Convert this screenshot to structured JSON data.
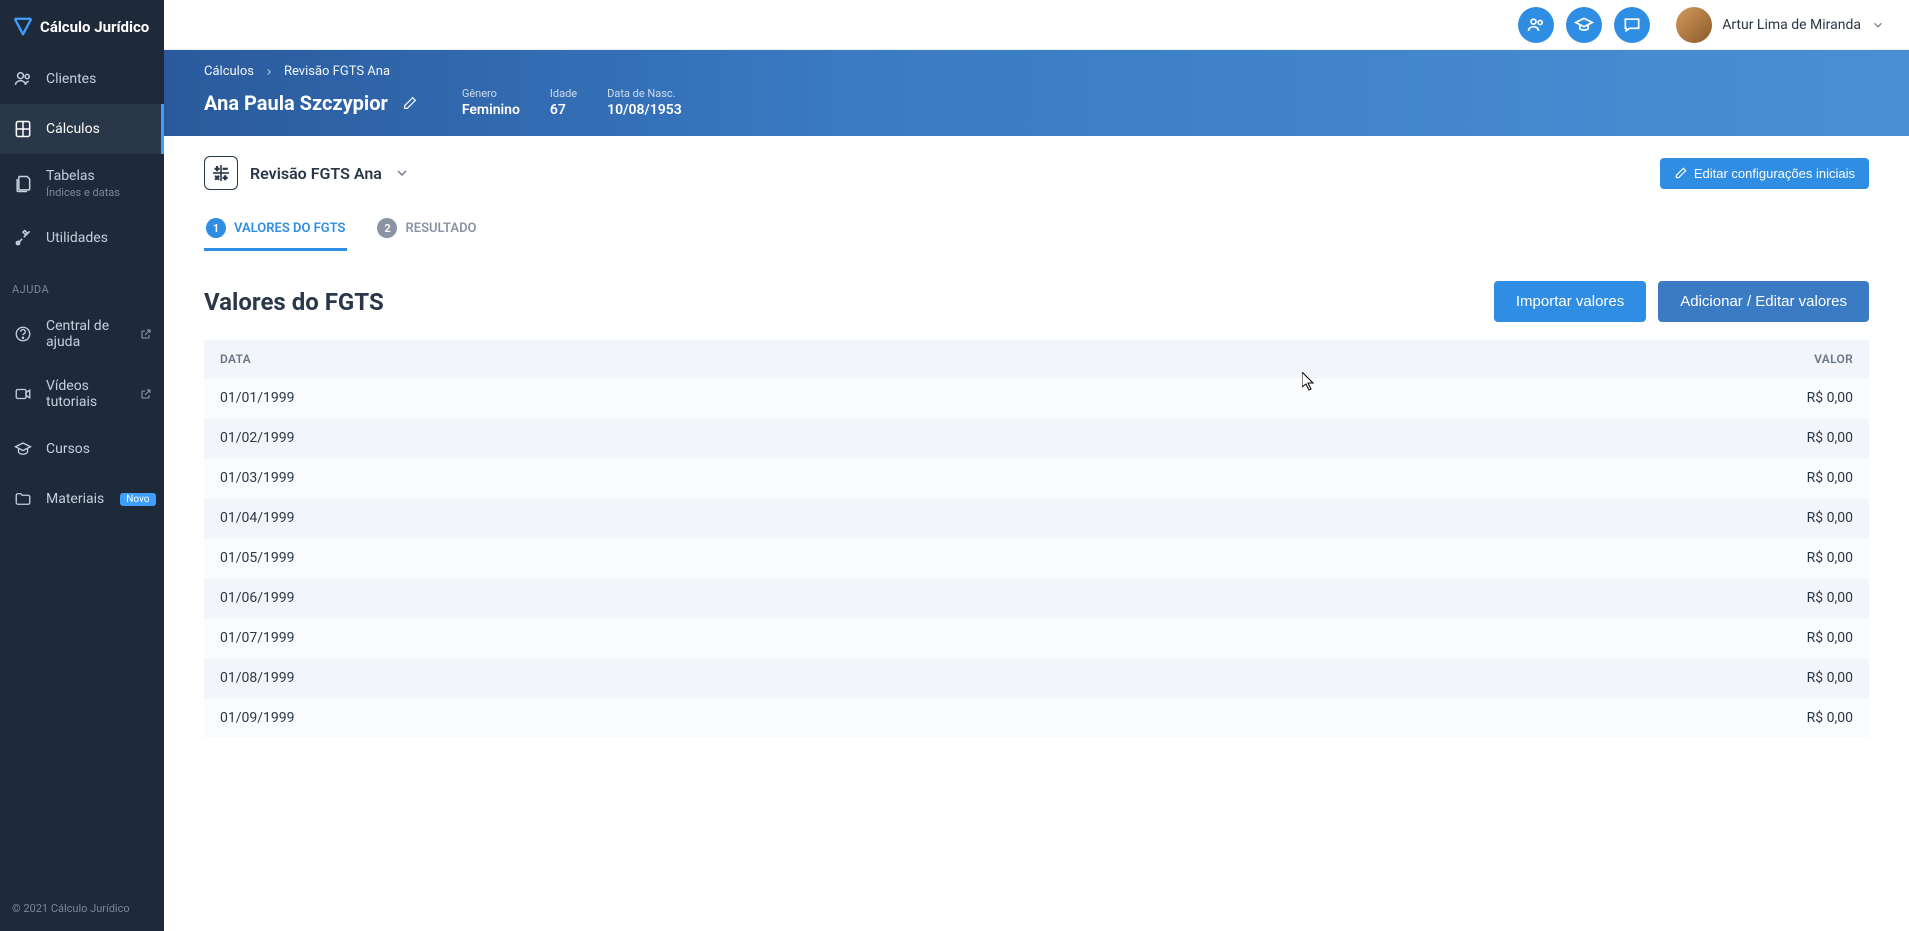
{
  "app": {
    "name": "Cálculo Jurídico"
  },
  "sidebar": {
    "items": [
      {
        "label": "Clientes"
      },
      {
        "label": "Cálculos"
      },
      {
        "label": "Tabelas",
        "sub": "Índices e datas"
      },
      {
        "label": "Utilidades"
      }
    ],
    "help_label": "AJUDA",
    "help_items": [
      {
        "label": "Central de ajuda"
      },
      {
        "label": "Vídeos tutoriais"
      },
      {
        "label": "Cursos"
      },
      {
        "label": "Materiais",
        "badge": "Novo"
      }
    ],
    "footer": "© 2021 Cálculo Jurídico"
  },
  "topbar": {
    "user_name": "Artur Lima de Miranda"
  },
  "breadcrumb": {
    "root": "Cálculos",
    "current": "Revisão FGTS Ana"
  },
  "client": {
    "name": "Ana Paula Szczypior",
    "meta": [
      {
        "label": "Gênero",
        "value": "Feminino"
      },
      {
        "label": "Idade",
        "value": "67"
      },
      {
        "label": "Data de Nasc.",
        "value": "10/08/1953"
      }
    ]
  },
  "section": {
    "title": "Revisão FGTS Ana",
    "edit_button": "Editar configurações iniciais"
  },
  "tabs": [
    {
      "num": "1",
      "label": "VALORES DO FGTS"
    },
    {
      "num": "2",
      "label": "RESULTADO"
    }
  ],
  "content": {
    "title": "Valores do FGTS",
    "import_button": "Importar valores",
    "add_button": "Adicionar / Editar valores",
    "headers": {
      "date": "DATA",
      "value": "VALOR"
    },
    "rows": [
      {
        "date": "01/01/1999",
        "value": "R$ 0,00"
      },
      {
        "date": "01/02/1999",
        "value": "R$ 0,00"
      },
      {
        "date": "01/03/1999",
        "value": "R$ 0,00"
      },
      {
        "date": "01/04/1999",
        "value": "R$ 0,00"
      },
      {
        "date": "01/05/1999",
        "value": "R$ 0,00"
      },
      {
        "date": "01/06/1999",
        "value": "R$ 0,00"
      },
      {
        "date": "01/07/1999",
        "value": "R$ 0,00"
      },
      {
        "date": "01/08/1999",
        "value": "R$ 0,00"
      },
      {
        "date": "01/09/1999",
        "value": "R$ 0,00"
      }
    ]
  }
}
